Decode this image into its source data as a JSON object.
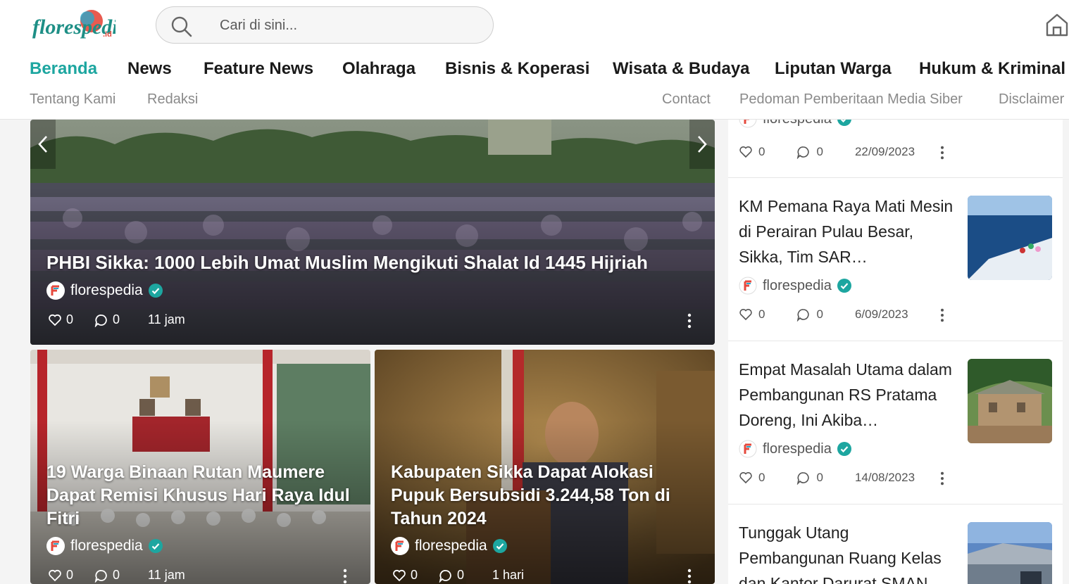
{
  "brand": {
    "logo_text": "florespedia",
    "logo_suffix": ".id",
    "accent": "#1da6a0"
  },
  "search": {
    "placeholder": "Cari di sini..."
  },
  "nav_primary": [
    "Beranda",
    "News",
    "Feature News",
    "Olahraga",
    "Bisnis & Koperasi",
    "Wisata & Budaya",
    "Liputan Warga",
    "Hukum & Kriminal"
  ],
  "nav_secondary": [
    "Tentang Kami",
    "Redaksi",
    "Contact",
    "Pedoman Pemberitaan Media Siber",
    "Disclaimer"
  ],
  "hero": {
    "title": "PHBI Sikka: 1000 Lebih Umat Muslim Mengikuti Shalat Id 1445 Hijriah",
    "author": "florespedia",
    "likes": "0",
    "comments": "0",
    "time": "11 jam"
  },
  "cards": [
    {
      "title": "19 Warga Binaan Rutan Maumere Dapat Remisi Khusus Hari Raya Idul Fitri",
      "author": "florespedia",
      "likes": "0",
      "comments": "0",
      "time": "11 jam"
    },
    {
      "title": "Kabupaten Sikka Dapat Alokasi Pupuk Bersubsidi 3.244,58 Ton di Tahun 2024",
      "author": "florespedia",
      "likes": "0",
      "comments": "0",
      "time": "1 hari"
    }
  ],
  "sidebar": [
    {
      "title": "",
      "author": "florespedia",
      "likes": "0",
      "comments": "0",
      "date": "22/09/2023"
    },
    {
      "title": "KM Pemana Raya Mati Mesin di Perairan Pulau Besar, Sikka, Tim SAR…",
      "author": "florespedia",
      "likes": "0",
      "comments": "0",
      "date": "6/09/2023"
    },
    {
      "title": "Empat Masalah Utama dalam Pembangunan RS Pratama Doreng, Ini Akiba…",
      "author": "florespedia",
      "likes": "0",
      "comments": "0",
      "date": "14/08/2023"
    },
    {
      "title": "Tunggak Utang Pembangunan Ruang Kelas dan Kantor Darurat SMAN",
      "author": "",
      "likes": "",
      "comments": "",
      "date": ""
    }
  ]
}
